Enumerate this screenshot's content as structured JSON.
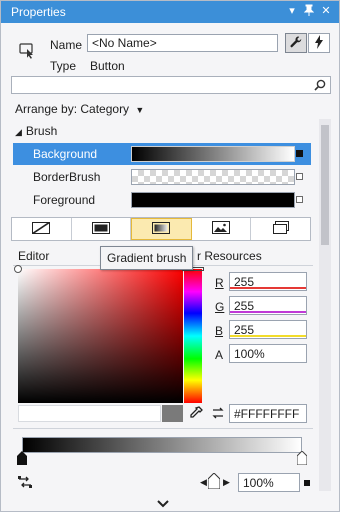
{
  "window": {
    "title": "Properties"
  },
  "header": {
    "name_label": "Name",
    "name_value": "<No Name>",
    "type_label": "Type",
    "type_value": "Button"
  },
  "search": {
    "placeholder": ""
  },
  "arrange": {
    "label": "Arrange by: Category"
  },
  "brush": {
    "section": "Brush",
    "rows": [
      {
        "label": "Background"
      },
      {
        "label": "BorderBrush"
      },
      {
        "label": "Foreground"
      }
    ]
  },
  "editor": {
    "label": "Editor",
    "resources_label": "r Resources",
    "tooltip": "Gradient brush"
  },
  "channels": {
    "r_label": "R",
    "r_value": "255",
    "r_color": "#e53935",
    "g_label": "G",
    "g_value": "255",
    "g_color": "#c03ad6",
    "b_label": "B",
    "b_value": "255",
    "b_color": "#f2dc2a",
    "a_label": "A",
    "a_value": "100%"
  },
  "color": {
    "hex_value": "#FFFFFFFF"
  },
  "gradient": {
    "stop_offset": "100%"
  },
  "icons": [
    "selection-icon",
    "wrench-icon",
    "lightning-icon",
    "search-icon"
  ]
}
